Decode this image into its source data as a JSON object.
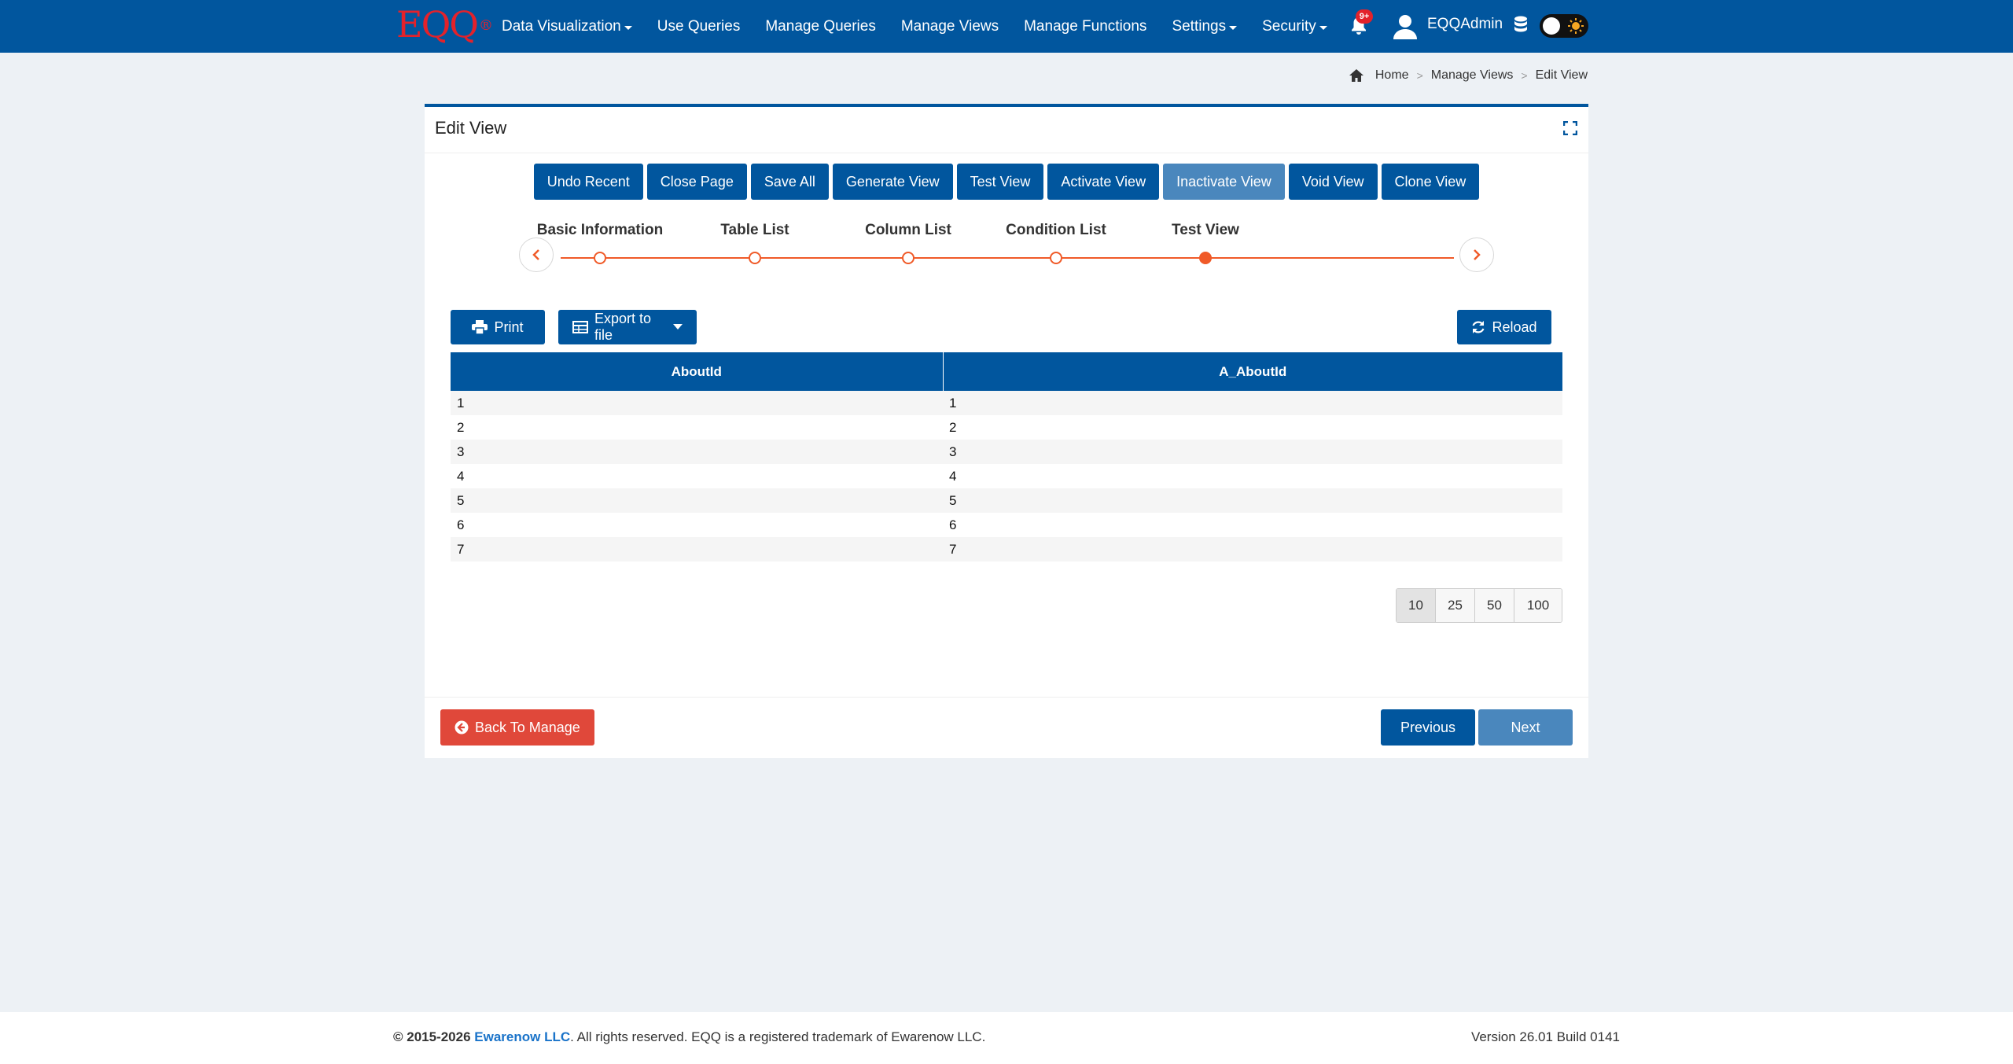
{
  "app": {
    "logo": "EQQ",
    "logo_mark": "®",
    "user": "EQQAdmin",
    "notification_count": "9+"
  },
  "nav": {
    "items": [
      {
        "label": "Data Visualization",
        "dropdown": true
      },
      {
        "label": "Use Queries",
        "dropdown": false
      },
      {
        "label": "Manage Queries",
        "dropdown": false
      },
      {
        "label": "Manage Views",
        "dropdown": false
      },
      {
        "label": "Manage Functions",
        "dropdown": false
      },
      {
        "label": "Settings",
        "dropdown": true
      },
      {
        "label": "Security",
        "dropdown": true
      }
    ]
  },
  "breadcrumb": [
    "Home",
    "Manage Views",
    "Edit View"
  ],
  "page": {
    "title": "Edit View"
  },
  "toolbar": {
    "buttons": [
      "Undo Recent",
      "Close Page",
      "Save All",
      "Generate View",
      "Test View",
      "Activate View",
      "Inactivate View",
      "Void View",
      "Clone View"
    ]
  },
  "stepper": {
    "steps": [
      "Basic Information",
      "Table List",
      "Column List",
      "Condition List",
      "Test View"
    ],
    "active_index": 4
  },
  "table_tools": {
    "print": "Print",
    "export": "Export to file",
    "reload": "Reload"
  },
  "grid": {
    "columns": [
      "AboutId",
      "A_AboutId"
    ],
    "rows": [
      [
        "1",
        "1"
      ],
      [
        "2",
        "2"
      ],
      [
        "3",
        "3"
      ],
      [
        "4",
        "4"
      ],
      [
        "5",
        "5"
      ],
      [
        "6",
        "6"
      ],
      [
        "7",
        "7"
      ]
    ]
  },
  "pager": {
    "sizes": [
      "10",
      "25",
      "50",
      "100"
    ],
    "selected": "10"
  },
  "actions": {
    "back": "Back To Manage",
    "previous": "Previous",
    "next": "Next"
  },
  "footer": {
    "years": "© 2015-2026",
    "company": "Ewarenow LLC",
    "rest": ". All rights reserved. EQQ is a registered trademark of Ewarenow LLC.",
    "version": "Version 26.01 Build 0141"
  },
  "colors": {
    "primary": "#01569e",
    "accent": "#f05a28",
    "danger": "#e0483a",
    "logo": "#e3222b"
  }
}
